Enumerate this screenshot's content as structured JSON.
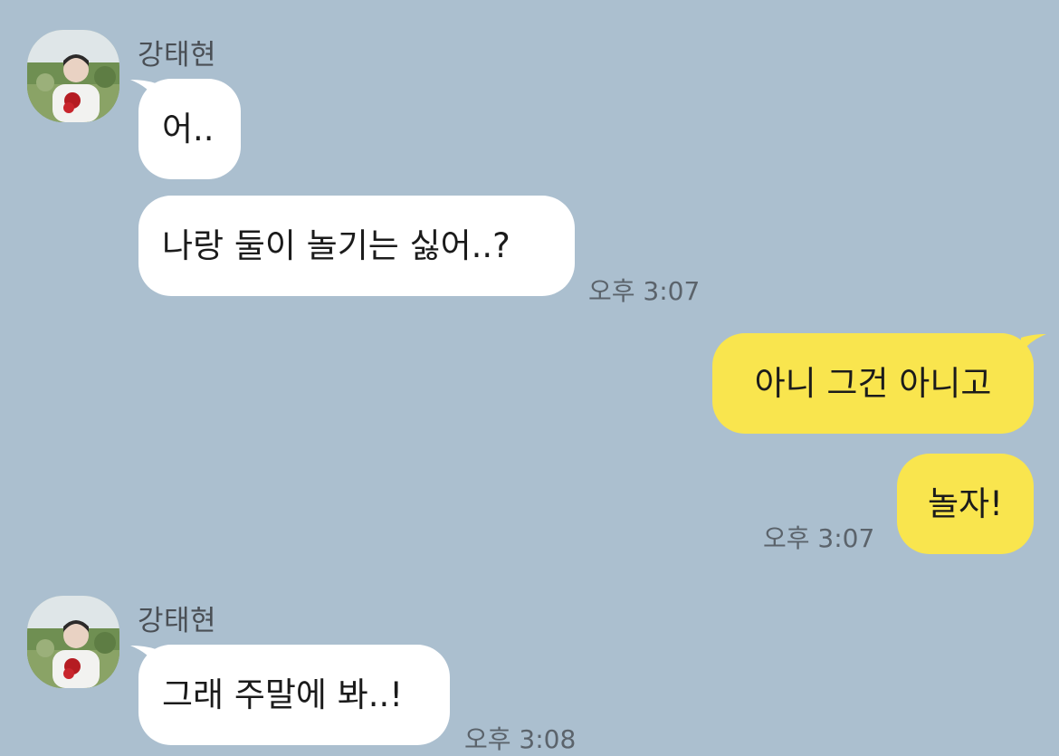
{
  "colors": {
    "background": "#abbfcf",
    "incoming_bubble": "#ffffff",
    "outgoing_bubble": "#f9e54e",
    "timestamp_text": "#5b636b"
  },
  "messages": [
    {
      "sender": "강태현",
      "avatar": "profile-photo-icon",
      "direction": "incoming",
      "bubbles": [
        "어..",
        "나랑 둘이 놀기는 싫어..?"
      ],
      "time": "오후 3:07"
    },
    {
      "direction": "outgoing",
      "bubbles": [
        "아니 그건 아니고",
        "놀자!"
      ],
      "time": "오후 3:07"
    },
    {
      "sender": "강태현",
      "avatar": "profile-photo-icon",
      "direction": "incoming",
      "bubbles": [
        "그래 주말에 봐..!"
      ],
      "time": "오후 3:08"
    }
  ]
}
